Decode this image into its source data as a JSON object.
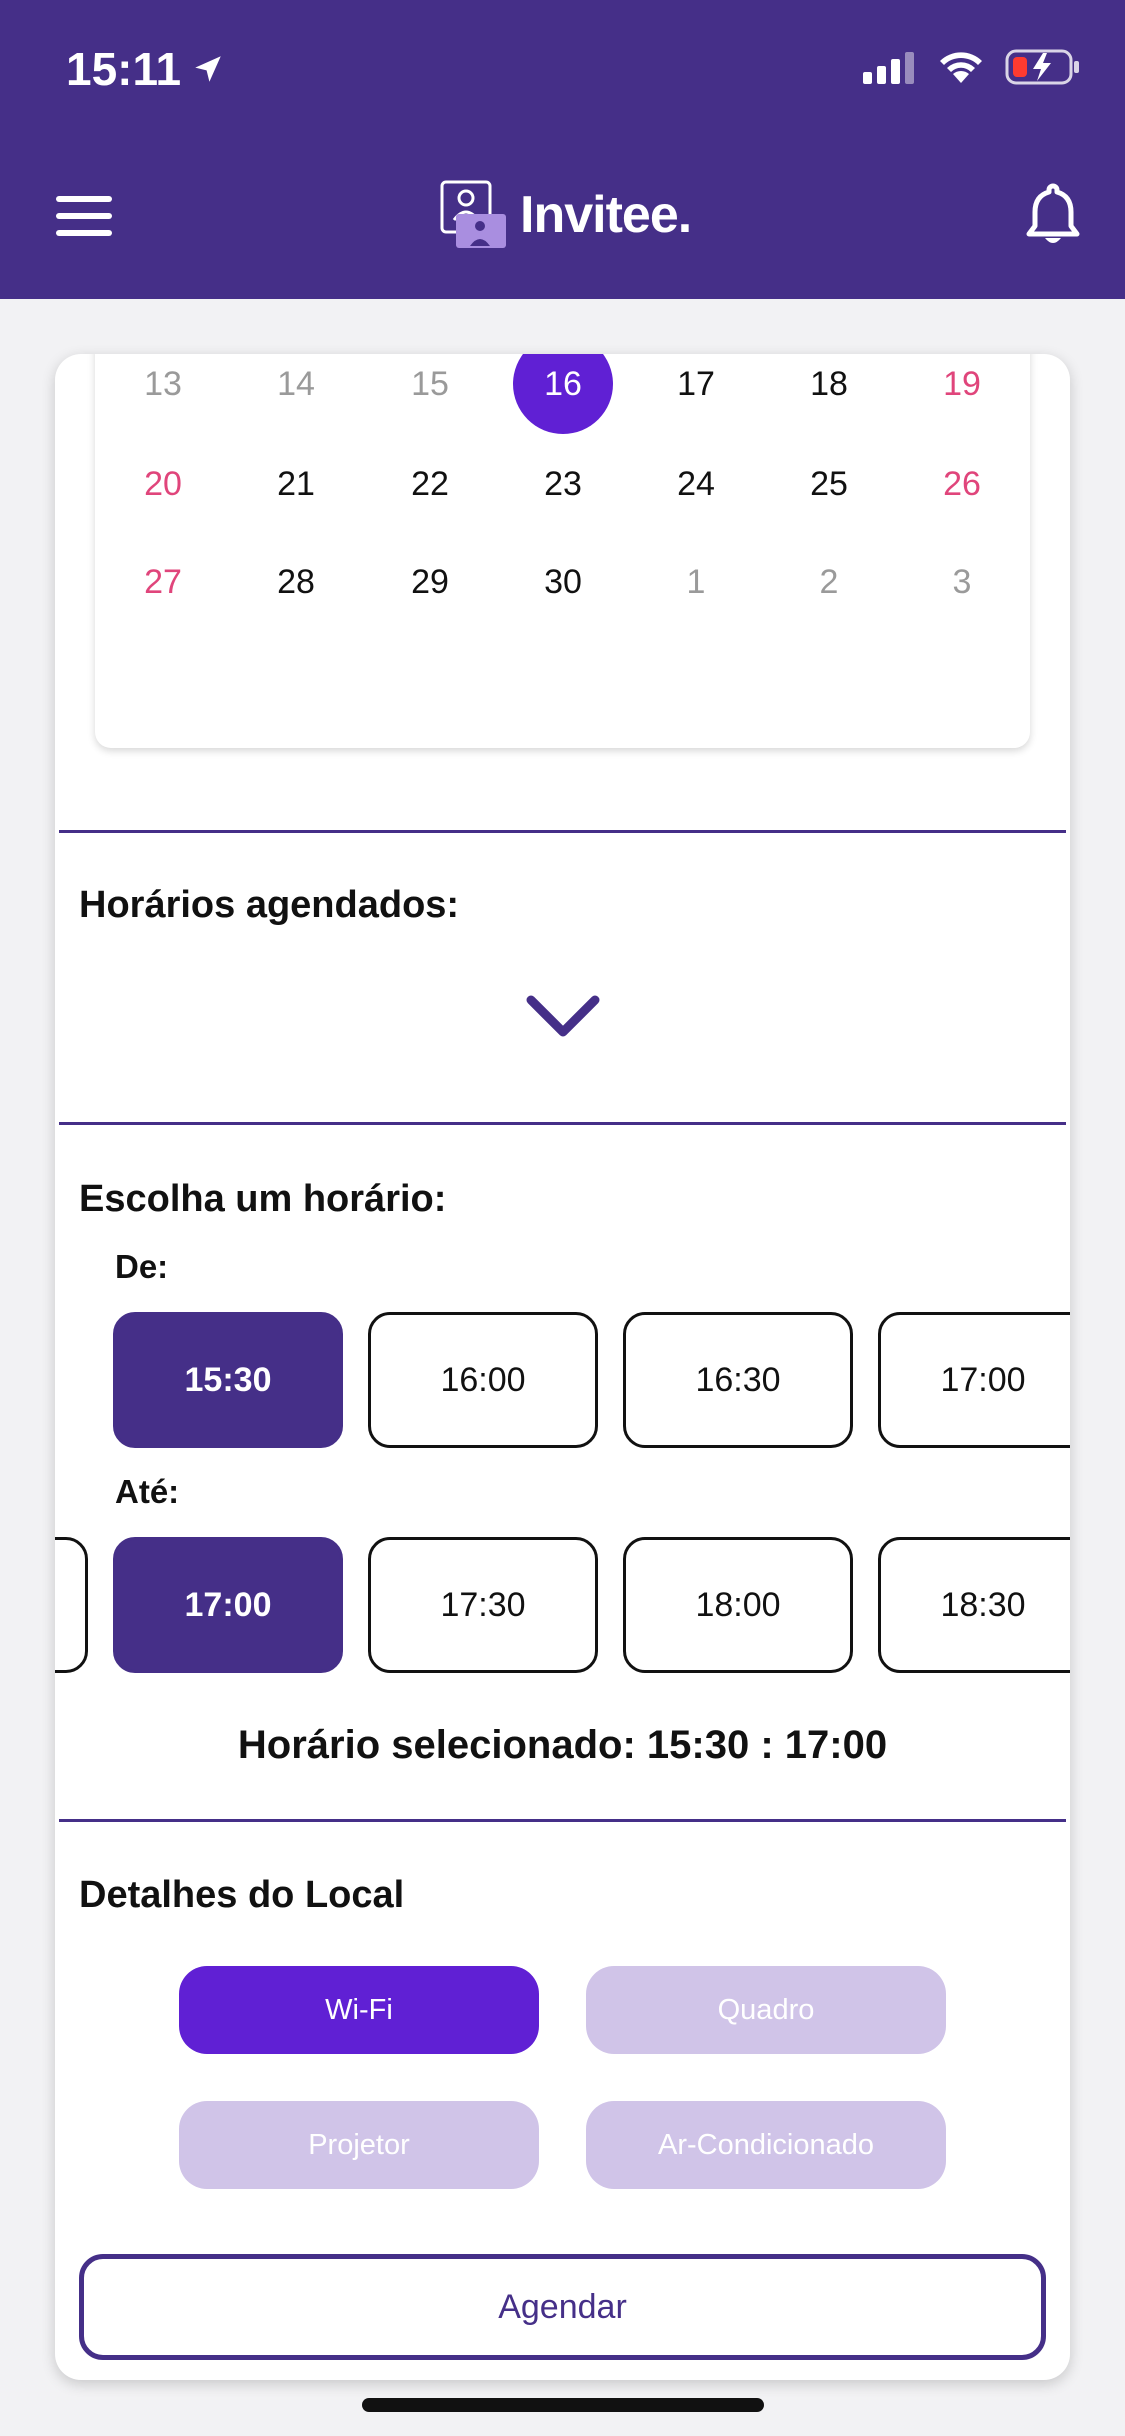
{
  "status_bar": {
    "time": "15:11"
  },
  "header": {
    "app_name": "Invitee."
  },
  "calendar": {
    "rows": [
      [
        {
          "d": "13",
          "k": "muted"
        },
        {
          "d": "14",
          "k": "muted"
        },
        {
          "d": "15",
          "k": "muted"
        },
        {
          "d": "16",
          "k": "selected"
        },
        {
          "d": "17",
          "k": ""
        },
        {
          "d": "18",
          "k": ""
        },
        {
          "d": "19",
          "k": "weekend"
        }
      ],
      [
        {
          "d": "20",
          "k": "weekend"
        },
        {
          "d": "21",
          "k": ""
        },
        {
          "d": "22",
          "k": ""
        },
        {
          "d": "23",
          "k": ""
        },
        {
          "d": "24",
          "k": ""
        },
        {
          "d": "25",
          "k": ""
        },
        {
          "d": "26",
          "k": "weekend"
        }
      ],
      [
        {
          "d": "27",
          "k": "weekend"
        },
        {
          "d": "28",
          "k": ""
        },
        {
          "d": "29",
          "k": ""
        },
        {
          "d": "30",
          "k": ""
        },
        {
          "d": "1",
          "k": "muted"
        },
        {
          "d": "2",
          "k": "muted"
        },
        {
          "d": "3",
          "k": "muted"
        }
      ]
    ],
    "selected_day": "16"
  },
  "scheduled": {
    "title": "Horários agendados:"
  },
  "choose": {
    "title": "Escolha um horário:",
    "from_label": "De:",
    "to_label": "Até:",
    "from_slots": [
      "15:30",
      "16:00",
      "16:30",
      "17:00"
    ],
    "from_selected": "15:30",
    "to_slots": [
      "",
      "17:00",
      "17:30",
      "18:00",
      "18:30"
    ],
    "to_selected": "17:00",
    "selected_text": "Horário selecionado: 15:30 : 17:00"
  },
  "details": {
    "title": "Detalhes do Local",
    "chips": [
      {
        "label": "Wi-Fi",
        "on": true
      },
      {
        "label": "Quadro",
        "on": false
      },
      {
        "label": "Projetor",
        "on": false
      },
      {
        "label": "Ar-Condicionado",
        "on": false
      }
    ]
  },
  "actions": {
    "schedule_button": "Agendar"
  },
  "colors": {
    "header": "#452f88",
    "accent": "#6020d4",
    "weekend": "#e0457b",
    "chip_off": "#d0c4e8"
  }
}
